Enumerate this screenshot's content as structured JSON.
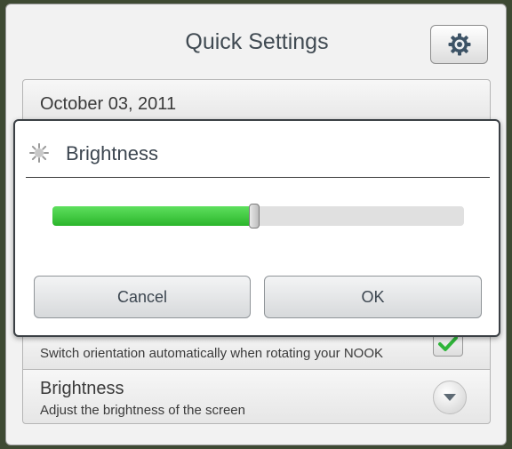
{
  "quick_settings": {
    "title": "Quick Settings",
    "settings_icon": "gear-icon"
  },
  "date_row": {
    "text": "October 03, 2011"
  },
  "orientation_row": {
    "description": "Switch orientation automatically when rotating your NOOK",
    "checked": true,
    "check_icon": "checkmark-icon",
    "check_color": "#2fb53a"
  },
  "brightness_row": {
    "title": "Brightness",
    "description": "Adjust the brightness of the screen",
    "expand_icon": "chevron-down-icon"
  },
  "dialog": {
    "title": "Brightness",
    "icon": "brightness-icon",
    "slider": {
      "value_fraction": 0.49,
      "fill_color": "#3cc83c"
    },
    "cancel_label": "Cancel",
    "ok_label": "OK"
  }
}
